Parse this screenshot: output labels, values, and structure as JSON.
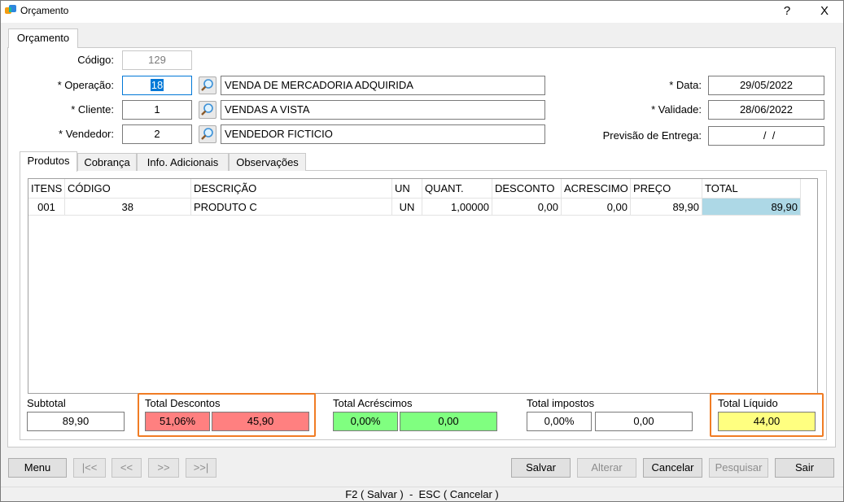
{
  "window": {
    "title": "Orçamento",
    "help": "?",
    "close": "X"
  },
  "outer_tab": "Orçamento",
  "form": {
    "codigo_label": "Código:",
    "codigo": "129",
    "operacao_label": "* Operação:",
    "operacao_code": "18",
    "operacao_desc": "VENDA DE MERCADORIA ADQUIRIDA",
    "cliente_label": "* Cliente:",
    "cliente_code": "1",
    "cliente_desc": "VENDAS A VISTA",
    "vendedor_label": "* Vendedor:",
    "vendedor_code": "2",
    "vendedor_desc": "VENDEDOR FICTICIO",
    "data_label": "* Data:",
    "data": "29/05/2022",
    "validade_label": "* Validade:",
    "validade": "28/06/2022",
    "previsao_label": "Previsão de Entrega:",
    "previsao": "  /  /"
  },
  "tabs": [
    "Produtos",
    "Cobrança",
    "Info. Adicionais",
    "Observações"
  ],
  "grid": {
    "headers": [
      "ITENS",
      "CÓDIGO",
      "DESCRIÇÃO",
      "UN",
      "QUANT.",
      "DESCONTO",
      "ACRESCIMO",
      "PREÇO",
      "TOTAL"
    ],
    "rows": [
      [
        "001",
        "38",
        "PRODUTO C",
        "UN",
        "1,00000",
        "0,00",
        "0,00",
        "89,90",
        "89,90"
      ]
    ]
  },
  "totals": {
    "subtotal_label": "Subtotal",
    "subtotal": "89,90",
    "descontos_label": "Total Descontos",
    "descontos_pct": "51,06%",
    "descontos_val": "45,90",
    "acrescimos_label": "Total Acréscimos",
    "acrescimos_pct": "0,00%",
    "acrescimos_val": "0,00",
    "impostos_label": "Total impostos",
    "impostos_pct": "0,00%",
    "impostos_val": "0,00",
    "liquido_label": "Total Líquido",
    "liquido": "44,00"
  },
  "buttons": {
    "menu": "Menu",
    "first": "|<<",
    "prev": "<<",
    "next": ">>",
    "last": ">>|",
    "salvar": "Salvar",
    "alterar": "Alterar",
    "cancelar": "Cancelar",
    "pesquisar": "Pesquisar",
    "sair": "Sair"
  },
  "status": "F2 ( Salvar )  -  ESC ( Cancelar )",
  "colors": {
    "accent": "#0078d7",
    "discount": "#ff8080",
    "addition": "#80ff80",
    "net": "#ffff80",
    "highlight_total": "#add8e6",
    "orange": "#f07c24"
  }
}
